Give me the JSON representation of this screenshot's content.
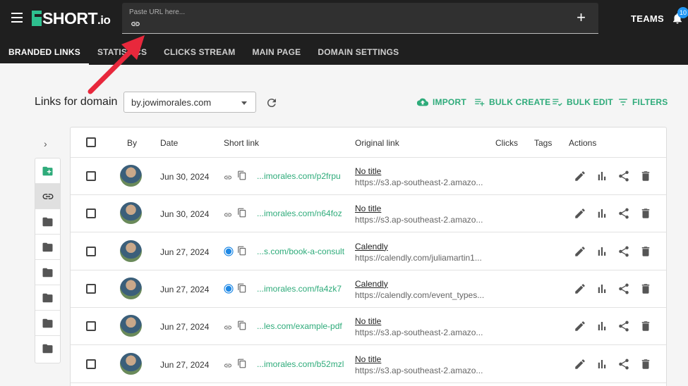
{
  "header": {
    "logo_text": "SHORT",
    "logo_suffix": ".io",
    "url_placeholder": "Paste URL here...",
    "teams_label": "TEAMS",
    "notification_count": "10"
  },
  "tabs": [
    {
      "label": "BRANDED LINKS"
    },
    {
      "label": "STATISTICS"
    },
    {
      "label": "CLICKS STREAM"
    },
    {
      "label": "MAIN PAGE"
    },
    {
      "label": "DOMAIN SETTINGS"
    }
  ],
  "toolbar": {
    "domain_label": "Links for domain",
    "domain_value": "by.jowimorales.com",
    "import_label": "IMPORT",
    "bulk_create_label": "BULK CREATE",
    "bulk_edit_label": "BULK EDIT",
    "filters_label": "FILTERS"
  },
  "table": {
    "columns": [
      "By",
      "Date",
      "Short link",
      "Original link",
      "Clicks",
      "Tags",
      "Actions"
    ],
    "rows": [
      {
        "date": "Jun 30, 2024",
        "short_link": "...imorales.com/p2frpu",
        "title": "No title",
        "url": "https://s3.ap-southeast-2.amazo...",
        "status_icon": "link-icon"
      },
      {
        "date": "Jun 30, 2024",
        "short_link": "...imorales.com/n64foz",
        "title": "No title",
        "url": "https://s3.ap-southeast-2.amazo...",
        "status_icon": "link-icon"
      },
      {
        "date": "Jun 27, 2024",
        "short_link": "...s.com/book-a-consult",
        "title": "Calendly",
        "url": "https://calendly.com/juliamartin1...",
        "status_icon": "radio-icon"
      },
      {
        "date": "Jun 27, 2024",
        "short_link": "...imorales.com/fa4zk7",
        "title": "Calendly",
        "url": "https://calendly.com/event_types...",
        "status_icon": "radio-icon"
      },
      {
        "date": "Jun 27, 2024",
        "short_link": "...les.com/example-pdf",
        "title": "No title",
        "url": "https://s3.ap-southeast-2.amazo...",
        "status_icon": "link-icon"
      },
      {
        "date": "Jun 27, 2024",
        "short_link": "...imorales.com/b52mzl",
        "title": "No title",
        "url": "https://s3.ap-southeast-2.amazo...",
        "status_icon": "link-icon"
      }
    ]
  },
  "colors": {
    "accent": "#2eab7a",
    "header_bg": "#1f1f1f",
    "annotation_arrow": "#e8283c"
  }
}
